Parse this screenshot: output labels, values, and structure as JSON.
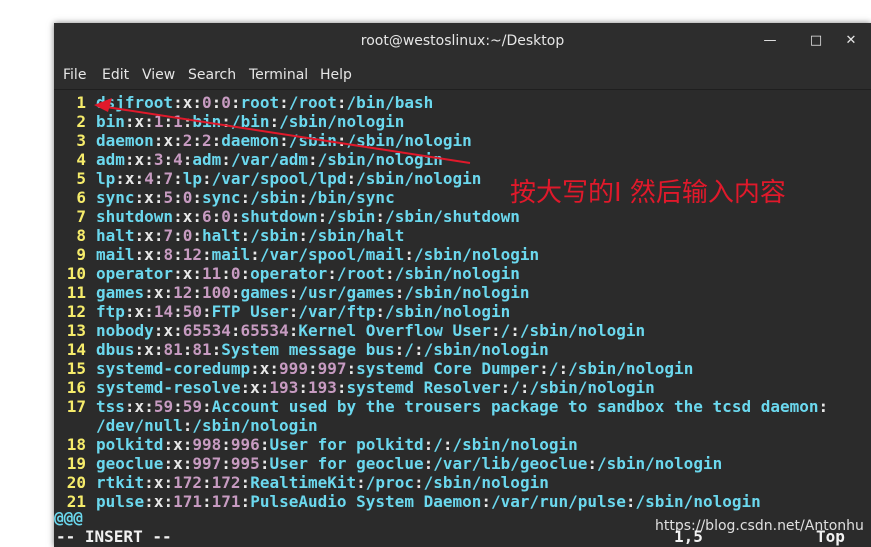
{
  "window": {
    "title": "root@westoslinux:~/Desktop",
    "minimize_glyph": "—",
    "maximize_glyph": "□",
    "close_glyph": "✕"
  },
  "menu": [
    "File",
    "Edit",
    "View",
    "Search",
    "Terminal",
    "Help"
  ],
  "lines": [
    {
      "num": "1",
      "fields": [
        "dsjfroot",
        "x",
        "0",
        "0",
        "root",
        "/root",
        "/bin/bash"
      ]
    },
    {
      "num": "2",
      "fields": [
        "bin",
        "x",
        "1",
        "1",
        "bin",
        "/bin",
        "/sbin/nologin"
      ]
    },
    {
      "num": "3",
      "fields": [
        "daemon",
        "x",
        "2",
        "2",
        "daemon",
        "/sbin",
        "/sbin/nologin"
      ]
    },
    {
      "num": "4",
      "fields": [
        "adm",
        "x",
        "3",
        "4",
        "adm",
        "/var/adm",
        "/sbin/nologin"
      ]
    },
    {
      "num": "5",
      "fields": [
        "lp",
        "x",
        "4",
        "7",
        "lp",
        "/var/spool/lpd",
        "/sbin/nologin"
      ]
    },
    {
      "num": "6",
      "fields": [
        "sync",
        "x",
        "5",
        "0",
        "sync",
        "/sbin",
        "/bin/sync"
      ]
    },
    {
      "num": "7",
      "fields": [
        "shutdown",
        "x",
        "6",
        "0",
        "shutdown",
        "/sbin",
        "/sbin/shutdown"
      ]
    },
    {
      "num": "8",
      "fields": [
        "halt",
        "x",
        "7",
        "0",
        "halt",
        "/sbin",
        "/sbin/halt"
      ]
    },
    {
      "num": "9",
      "fields": [
        "mail",
        "x",
        "8",
        "12",
        "mail",
        "/var/spool/mail",
        "/sbin/nologin"
      ]
    },
    {
      "num": "10",
      "fields": [
        "operator",
        "x",
        "11",
        "0",
        "operator",
        "/root",
        "/sbin/nologin"
      ]
    },
    {
      "num": "11",
      "fields": [
        "games",
        "x",
        "12",
        "100",
        "games",
        "/usr/games",
        "/sbin/nologin"
      ]
    },
    {
      "num": "12",
      "fields": [
        "ftp",
        "x",
        "14",
        "50",
        "FTP User",
        "/var/ftp",
        "/sbin/nologin"
      ]
    },
    {
      "num": "13",
      "fields": [
        "nobody",
        "x",
        "65534",
        "65534",
        "Kernel Overflow User",
        "/",
        "/sbin/nologin"
      ]
    },
    {
      "num": "14",
      "fields": [
        "dbus",
        "x",
        "81",
        "81",
        "System message bus",
        "/",
        "/sbin/nologin"
      ]
    },
    {
      "num": "15",
      "fields": [
        "systemd-coredump",
        "x",
        "999",
        "997",
        "systemd Core Dumper",
        "/",
        "/sbin/nologin"
      ]
    },
    {
      "num": "16",
      "fields": [
        "systemd-resolve",
        "x",
        "193",
        "193",
        "systemd Resolver",
        "/",
        "/sbin/nologin"
      ]
    },
    {
      "num": "17",
      "fields": [
        "tss",
        "x",
        "59",
        "59",
        "Account used by the trousers package to sandbox the tcsd daemon",
        "/dev/null",
        "/sbin/nologin"
      ]
    },
    {
      "num": "18",
      "fields": [
        "polkitd",
        "x",
        "998",
        "996",
        "User for polkitd",
        "/",
        "/sbin/nologin"
      ]
    },
    {
      "num": "19",
      "fields": [
        "geoclue",
        "x",
        "997",
        "995",
        "User for geoclue",
        "/var/lib/geoclue",
        "/sbin/nologin"
      ]
    },
    {
      "num": "20",
      "fields": [
        "rtkit",
        "x",
        "172",
        "172",
        "RealtimeKit",
        "/proc",
        "/sbin/nologin"
      ]
    },
    {
      "num": "21",
      "fields": [
        "pulse",
        "x",
        "171",
        "171",
        "PulseAudio System Daemon",
        "/var/run/pulse",
        "/sbin/nologin"
      ]
    }
  ],
  "filler": "@@@",
  "status": {
    "mode": "-- INSERT --",
    "position": "1,5",
    "scroll": "Top"
  },
  "annotation_text": "按大写的I 然后输入内容",
  "watermark": "https://blog.csdn.net/Antonhu",
  "colors": {
    "annotation": "#e0192b",
    "line_number": "#f6ec6b",
    "field_text": "#6bd8ee",
    "id_numbers": "#c79bc1",
    "terminal_bg": "#2b2b2b"
  }
}
